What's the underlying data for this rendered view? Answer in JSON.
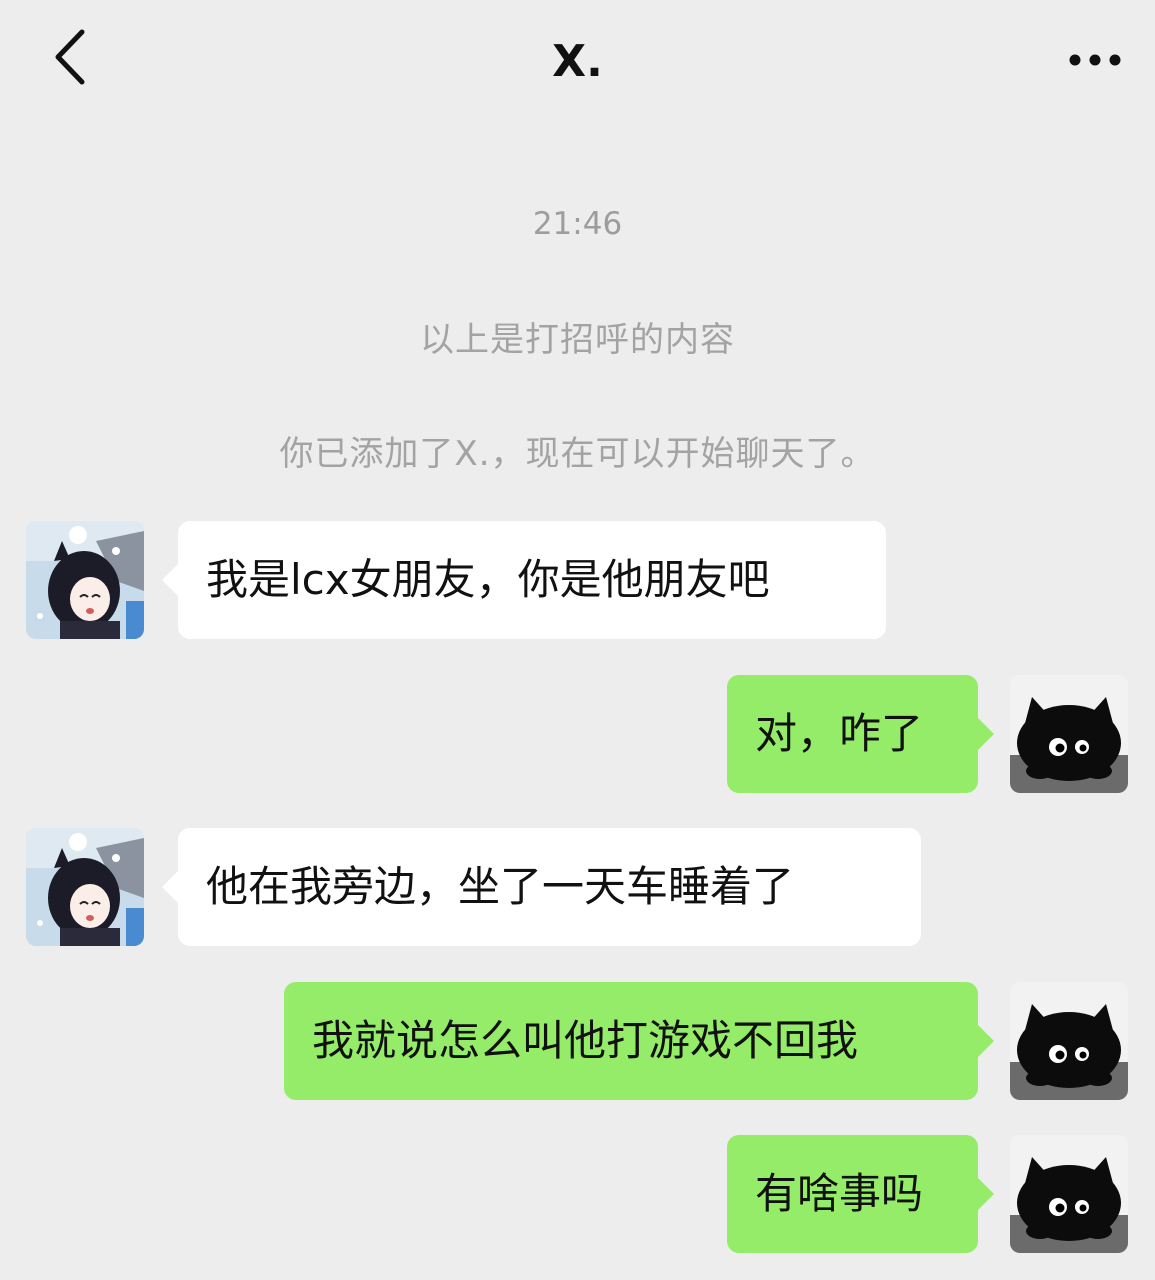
{
  "header": {
    "title": "X.",
    "back_icon": "chevron-left-icon",
    "more_icon": "more-dots-icon"
  },
  "chat": {
    "timestamp": "21:46",
    "system_messages": [
      "以上是打招呼的内容",
      "你已添加了X.，现在可以开始聊天了。"
    ],
    "messages": [
      {
        "side": "in",
        "text": "我是lcx女朋友，你是他朋友吧"
      },
      {
        "side": "out",
        "text": "对，咋了"
      },
      {
        "side": "in",
        "text": "他在我旁边，坐了一天车睡着了"
      },
      {
        "side": "out",
        "text": "我就说怎么叫他打游戏不回我"
      },
      {
        "side": "out",
        "text": "有啥事吗"
      }
    ]
  },
  "colors": {
    "background": "#ededed",
    "incoming_bubble": "#ffffff",
    "outgoing_bubble": "#95ec69",
    "system_text": "#a3a3a3"
  }
}
